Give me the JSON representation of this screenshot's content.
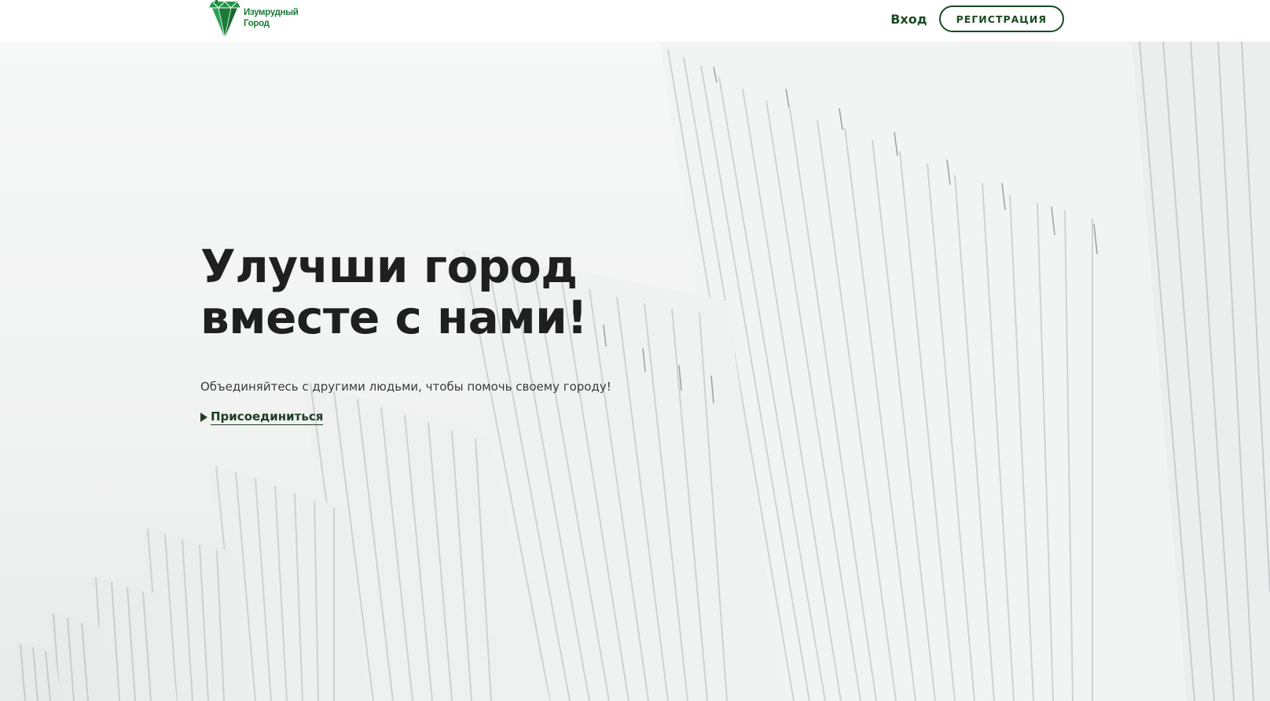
{
  "header": {
    "logo": {
      "line1": "Изумрудный",
      "line2": "Город",
      "icon": "emerald-gem-icon",
      "color": "#1b7a37"
    },
    "nav": {
      "login_label": "Вход",
      "register_label": "РЕГИСТРАЦИЯ"
    }
  },
  "hero": {
    "title_line1": "Улучши город",
    "title_line2": "вместе с нами!",
    "subtitle": "Объединяйтесь с другими людьми, чтобы помочь своему городу!",
    "cta_label": "Присоединиться",
    "cta_icon": "play-triangle-icon"
  },
  "colors": {
    "accent_dark_green": "#1a4a22",
    "brand_green": "#1b7a37",
    "title_text": "#1f1f1f"
  }
}
